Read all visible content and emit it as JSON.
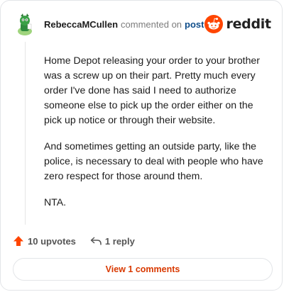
{
  "header": {
    "username": "RebeccaMCullen",
    "action": "commented on",
    "post_link": "post",
    "brand": "reddit"
  },
  "comment": {
    "paragraphs": [
      "Home Depot releasing your order to your brother was a screw up on their part. Pretty much every order I've done has said I need to authorize someone else to pick up the order either on the pick up notice or through their website.",
      "And sometimes getting an outside party, like the police, is necessary to deal with people who have zero respect for those around them.",
      "NTA."
    ]
  },
  "footer": {
    "upvotes": "10 upvotes",
    "replies": "1 reply"
  },
  "view_button": "View 1 comments",
  "colors": {
    "brand": "#ff4500",
    "upvote": "#ff4500",
    "link": "#0f4d8a",
    "button_text": "#d93900"
  },
  "icons": {
    "avatar": "avatar-icon",
    "brand": "reddit-logo-icon",
    "upvote": "upvote-arrow-icon",
    "reply": "reply-arrow-icon"
  }
}
